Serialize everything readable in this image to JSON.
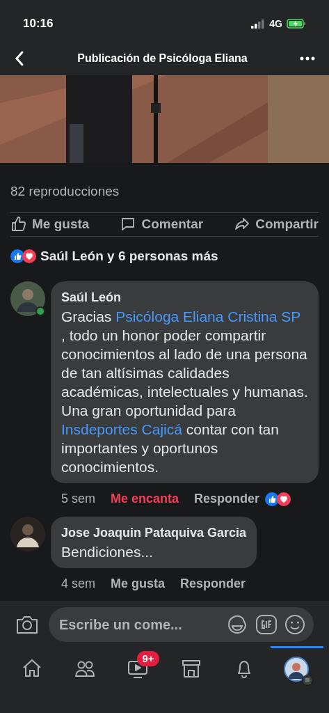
{
  "status_bar": {
    "time": "10:16",
    "network": "4G"
  },
  "header": {
    "title": "Publicación de Psicóloga Eliana"
  },
  "views": "82 reproducciones",
  "actions": [
    {
      "kind": "like",
      "label": "Me gusta"
    },
    {
      "kind": "comment",
      "label": "Comentar"
    },
    {
      "kind": "share",
      "label": "Compartir"
    }
  ],
  "reactions_summary": "Saúl León y 6 personas más",
  "comments": [
    {
      "author": "Saúl León",
      "online": true,
      "segments": [
        {
          "text": "Gracias ",
          "link": false
        },
        {
          "text": "Psicóloga Eliana Cristina SP",
          "link": true
        },
        {
          "text": " , todo un honor poder compartir conocimientos al lado de una persona de tan altísimas calidades académicas, intelectuales y humanas. Una gran oportunidad para ",
          "link": false
        },
        {
          "text": "Insdeportes Cajicá",
          "link": true
        },
        {
          "text": " contar con tan importantes y oportunos conocimientos.",
          "link": false
        }
      ],
      "time": "5 sem",
      "reaction": {
        "label": "Me encanta",
        "selected": true
      },
      "reply": "Responder",
      "has_reactions": true
    },
    {
      "author": "Jose Joaquin Pataquiva Garcia",
      "online": false,
      "segments": [
        {
          "text": "Bendiciones...",
          "link": false
        }
      ],
      "time": "4 sem",
      "reaction": {
        "label": "Me gusta",
        "selected": false
      },
      "reply": "Responder",
      "has_reactions": false
    }
  ],
  "composer": {
    "placeholder": "Escribe un come..."
  },
  "nav": [
    {
      "kind": "home",
      "selected": false
    },
    {
      "kind": "friends",
      "selected": false
    },
    {
      "kind": "video",
      "selected": false,
      "badge": "9+"
    },
    {
      "kind": "marketplace",
      "selected": false
    },
    {
      "kind": "notifications",
      "selected": false
    },
    {
      "kind": "profile",
      "selected": true
    }
  ]
}
